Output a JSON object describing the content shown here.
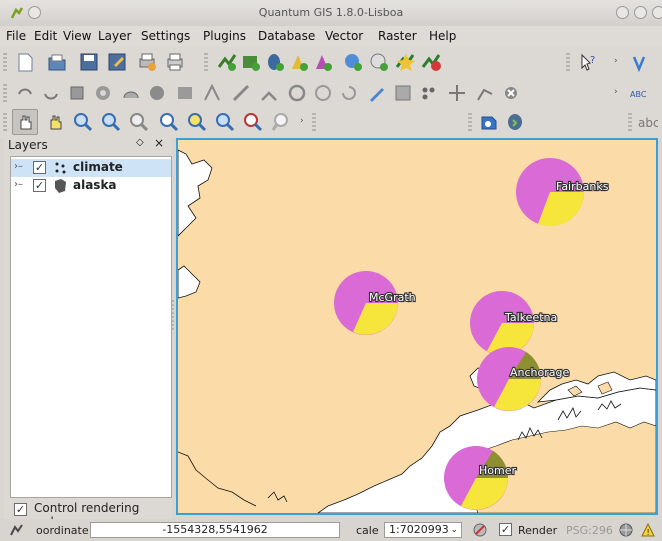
{
  "window": {
    "title": "Quantum GIS 1.8.0-Lisboa"
  },
  "menu": [
    "File",
    "Edit",
    "View",
    "Layer",
    "Settings",
    "Plugins",
    "Database",
    "Vector",
    "Raster",
    "Help"
  ],
  "layers_panel": {
    "title": "Layers",
    "float_glyph": "◇",
    "close_glyph": "×",
    "layers": [
      {
        "name": "climate",
        "checked": true,
        "selected": true
      },
      {
        "name": "alaska",
        "checked": true,
        "selected": false
      }
    ],
    "control_rendering_order": "Control rendering order"
  },
  "map": {
    "land_color": "#fbdba8",
    "water_color": "#ffffff",
    "pie_colors": {
      "major": "#d96ad6",
      "minor": "#f6e53a",
      "third": "#8e8f30"
    },
    "cities": [
      {
        "name": "Fairbanks"
      },
      {
        "name": "McGrath"
      },
      {
        "name": "Talkeetna"
      },
      {
        "name": "Anchorage"
      },
      {
        "name": "Homer"
      }
    ]
  },
  "status": {
    "coordinate_label": "oordinate",
    "coordinate_value": "-1554328,5541962",
    "scale_label": "cale",
    "scale_value": "1:7020993",
    "render_label": "Render",
    "render_checked": true,
    "crs": "PSG:296"
  }
}
